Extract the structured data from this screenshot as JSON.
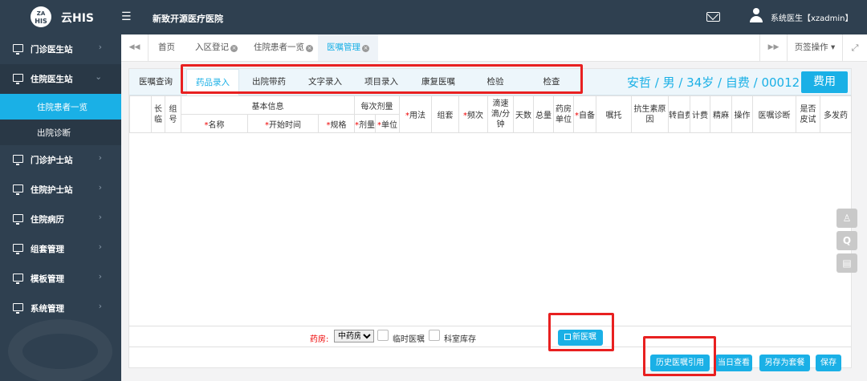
{
  "app": {
    "logo_text": "ZA",
    "logo_sub": "HIS",
    "title": "云HIS",
    "hospital": "新致开源医疗医院",
    "user": "系统医生【xzadmin】"
  },
  "sidebar": {
    "items": [
      {
        "label": "门诊医生站"
      },
      {
        "label": "住院医生站"
      },
      {
        "label": "门诊护士站"
      },
      {
        "label": "住院护士站"
      },
      {
        "label": "住院病历"
      },
      {
        "label": "组套管理"
      },
      {
        "label": "模板管理"
      },
      {
        "label": "系统管理"
      }
    ],
    "sub_items": [
      {
        "label": "住院患者一览"
      },
      {
        "label": "出院诊断"
      }
    ]
  },
  "page_tabs": [
    {
      "label": "首页"
    },
    {
      "label": "入区登记"
    },
    {
      "label": "住院患者一览"
    },
    {
      "label": "医嘱管理"
    }
  ],
  "page_ops": "页签操作",
  "sub_tabs": [
    "医嘱查询",
    "药品录入",
    "出院带药",
    "文字录入",
    "项目录入",
    "康复医嘱",
    "检验",
    "检查"
  ],
  "patient": {
    "info": "安哲 / 男 / 34岁 / 自费 / 00012 /",
    "fee_button": "费用"
  },
  "grid": {
    "header": {
      "changlin": "长临",
      "zuhao": "组号",
      "basic": "基本信息",
      "per_dose": "每次剂量",
      "name": "名称",
      "start_time": "开始时间",
      "spec": "规格",
      "dose": "剂量",
      "unit": "单位",
      "usage": "用法",
      "group": "组套",
      "freq": "频次",
      "drip": "滴速滴/分钟",
      "days": "天数",
      "total": "总量",
      "pharm_unit": "药房单位",
      "self": "自备",
      "instruction": "嘱托",
      "antibiotic": "抗生素原因",
      "transfer": "转自费",
      "billing": "计费",
      "narcotic": "精麻",
      "operation": "操作",
      "diagnosis": "医嘱诊断",
      "skin_test": "是否皮试",
      "multi": "多发药"
    }
  },
  "bottom": {
    "pharm_label": "药房:",
    "pharm_value": "中药房",
    "temp_order": "临时医嘱",
    "dept_stock": "科室库存",
    "new_order": "新医嘱"
  },
  "actions": {
    "history": "历史医嘱引用",
    "today": "当日查看",
    "save_as_set": "另存为套餐",
    "save": "保存"
  }
}
